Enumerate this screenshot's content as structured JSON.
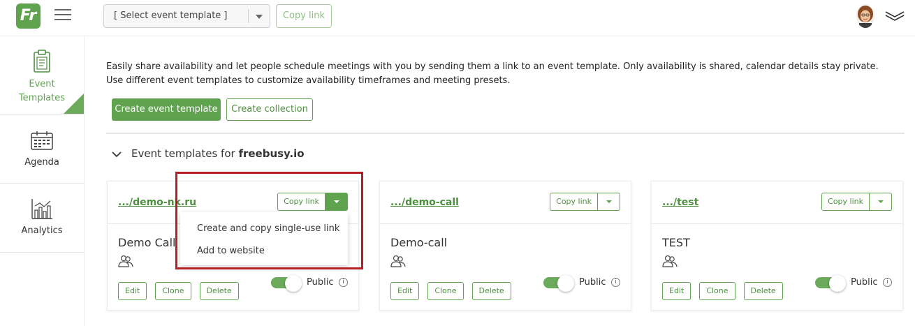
{
  "topbar": {
    "logo_text": "Fr",
    "template_select": {
      "selected": "[ Select event template ]"
    },
    "copy_link_label": "Copy link"
  },
  "sidebar": {
    "items": [
      {
        "label_line1": "Event",
        "label_line2": "Templates",
        "icon": "clipboard-icon",
        "active": true
      },
      {
        "label": "Agenda",
        "icon": "calendar-icon",
        "active": false
      },
      {
        "label": "Analytics",
        "icon": "bar-chart-icon",
        "active": false
      }
    ]
  },
  "main": {
    "intro_line1": "Easily share availability and let people schedule meetings with you by sending them a link to an event template. Only availability is shared, calendar details stay private.",
    "intro_line2": "Use different event templates to customize availability timeframes and meeting presets.",
    "create_event_template_label": "Create event template",
    "create_collection_label": "Create collection",
    "section_title_prefix": "Event templates for ",
    "section_title_domain": "freebusy.io",
    "cards": [
      {
        "slug": ".../demo-nk.ru",
        "copy_label": "Copy link",
        "name": "Demo Call",
        "edit": "Edit",
        "clone": "Clone",
        "delete": "Delete",
        "public_label": "Public",
        "public_on": true,
        "dropdown_open": true
      },
      {
        "slug": ".../demo-call",
        "copy_label": "Copy link",
        "name": "Demo-call",
        "edit": "Edit",
        "clone": "Clone",
        "delete": "Delete",
        "public_label": "Public",
        "public_on": true,
        "dropdown_open": false
      },
      {
        "slug": ".../test",
        "copy_label": "Copy link",
        "name": "TEST",
        "edit": "Edit",
        "clone": "Clone",
        "delete": "Delete",
        "public_label": "Public",
        "public_on": true,
        "dropdown_open": false
      }
    ],
    "dropdown_menu": {
      "items": [
        "Create and copy single-use link",
        "Add to website"
      ]
    }
  },
  "colors": {
    "brand_green": "#5fa34f",
    "highlight_red": "#b41f24"
  }
}
